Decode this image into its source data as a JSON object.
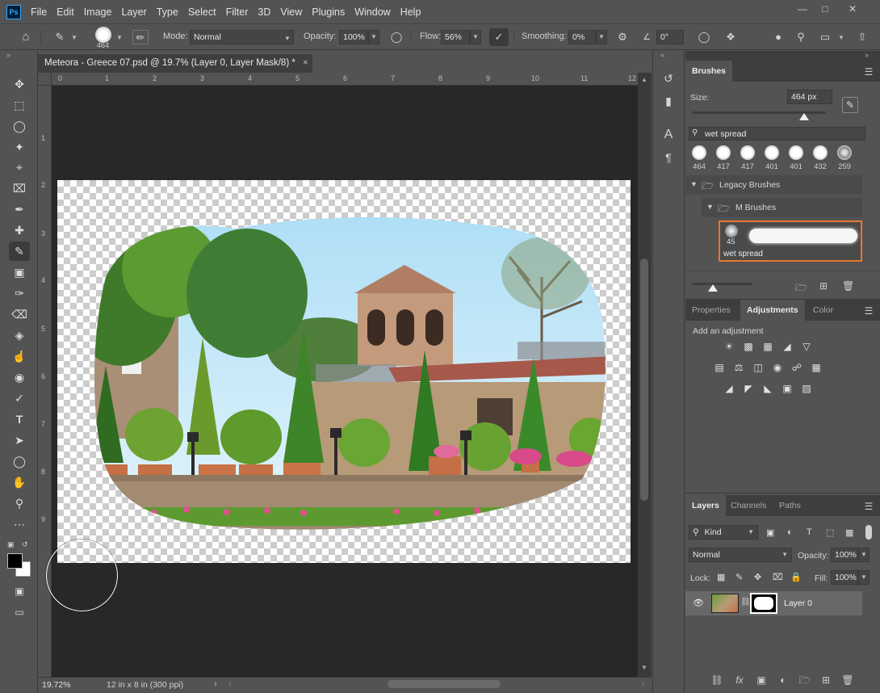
{
  "app": {
    "logo_text": "Ps"
  },
  "menu": [
    "File",
    "Edit",
    "Image",
    "Layer",
    "Type",
    "Select",
    "Filter",
    "3D",
    "View",
    "Plugins",
    "Window",
    "Help"
  ],
  "window_controls": {
    "minimize": "—",
    "maximize": "□",
    "close": "✕"
  },
  "options_bar": {
    "brush_size": "464",
    "mode_label": "Mode:",
    "mode_value": "Normal",
    "opacity_label": "Opacity:",
    "opacity_value": "100%",
    "flow_label": "Flow:",
    "flow_value": "56%",
    "smoothing_label": "Smoothing:",
    "smoothing_value": "0%",
    "angle_value": "0°"
  },
  "document": {
    "tab_title": "Meteora - Greece 07.psd @ 19.7% (Layer 0, Layer Mask/8) *",
    "close_glyph": "×",
    "ruler_top_ticks": [
      "0",
      "1",
      "2",
      "3",
      "4",
      "5",
      "6",
      "7",
      "8",
      "9",
      "10",
      "11",
      "12"
    ],
    "ruler_left_ticks": [
      "1",
      "2",
      "3",
      "4",
      "5",
      "6",
      "7",
      "8",
      "9"
    ],
    "zoom": "19.72%",
    "doc_info": "12 in x 8 in (300 ppi)"
  },
  "brushes_panel": {
    "tab": "Brushes",
    "size_label": "Size:",
    "size_value": "464 px",
    "size_fraction": 0.84,
    "search_value": "wet spread",
    "recent_brushes": [
      "464",
      "417",
      "417",
      "401",
      "401",
      "432",
      "259"
    ],
    "folder_1": "Legacy Brushes",
    "folder_2": "M Brushes",
    "selected_brush_size": "45",
    "selected_brush_name": "wet spread",
    "preview_slider_fraction": 0.35
  },
  "adjustments_panel": {
    "tabs": [
      "Properties",
      "Adjustments",
      "Color"
    ],
    "active_tab": "Adjustments",
    "add_label": "Add an adjustment"
  },
  "layers_panel": {
    "tabs": [
      "Layers",
      "Channels",
      "Paths"
    ],
    "active_tab": "Layers",
    "filter_kind": "Kind",
    "blend_mode": "Normal",
    "opacity_label": "Opacity:",
    "opacity_value": "100%",
    "lock_label": "Lock:",
    "fill_label": "Fill:",
    "fill_value": "100%",
    "layer_name": "Layer 0"
  },
  "colors": {
    "panel_bg": "#535353",
    "doc_bg": "#282828",
    "selection_orange": "#e8772e",
    "ps_blue": "#31a8ff"
  }
}
